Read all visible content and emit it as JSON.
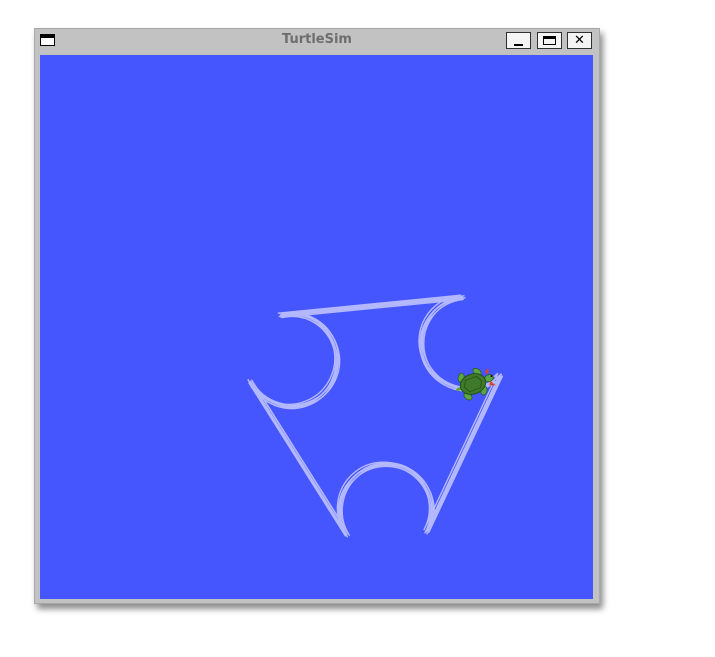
{
  "window": {
    "title": "TurtleSim"
  },
  "controls": {
    "menu_icon": "window-menu-icon",
    "minimize_icon": "minimize-icon",
    "maximize_icon": "maximize-icon",
    "close_icon": "close-icon",
    "close_glyph": "✕"
  },
  "canvas": {
    "background_color": "#4556ff",
    "pen_color": "#b3b8ff"
  },
  "turtle": {
    "icon": "turtle-icon",
    "shell_color": "#3e7a2a",
    "skin_color": "#5aa548"
  }
}
